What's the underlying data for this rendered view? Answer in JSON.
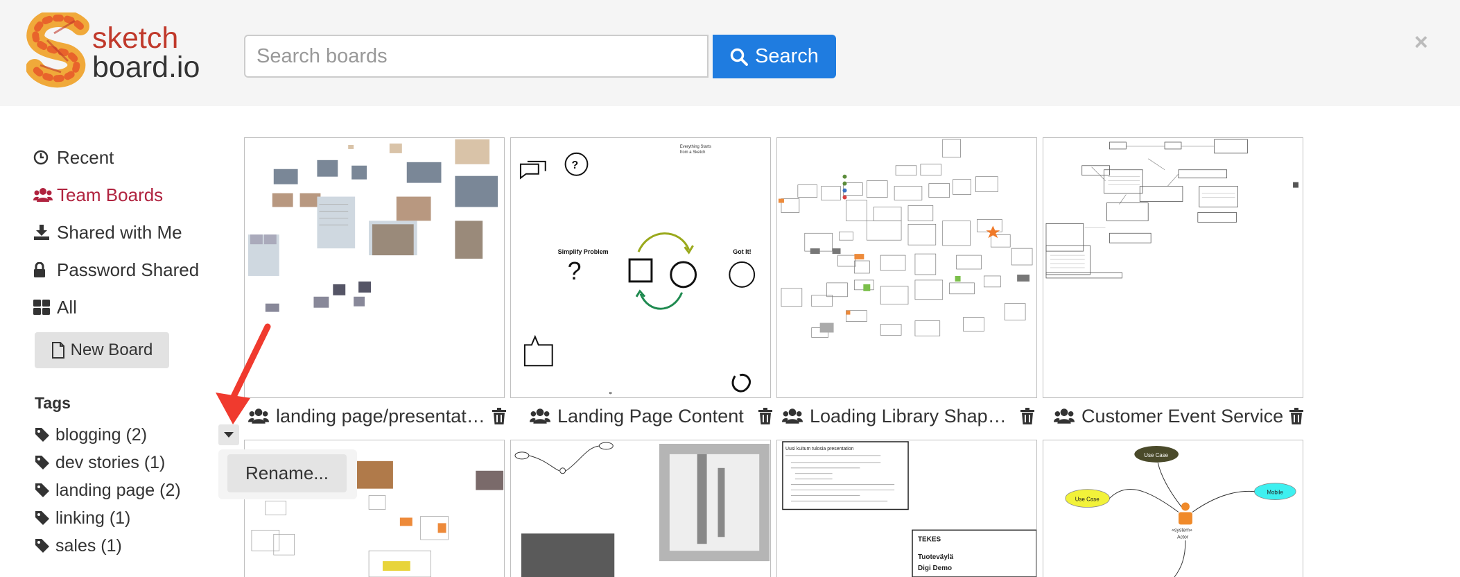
{
  "logo": {
    "line1": "sketch",
    "line2": "board.io"
  },
  "search": {
    "placeholder": "Search boards",
    "value": "",
    "button_label": "Search"
  },
  "close_label": "×",
  "sidebar": {
    "items": [
      {
        "label": "Recent",
        "icon": "clock-icon",
        "active": false
      },
      {
        "label": "Team Boards",
        "icon": "users-icon",
        "active": true
      },
      {
        "label": "Shared with Me",
        "icon": "download-icon",
        "active": false
      },
      {
        "label": "Password Shared",
        "icon": "lock-icon",
        "active": false
      },
      {
        "label": "All",
        "icon": "grid-icon",
        "active": false
      }
    ],
    "new_board_label": "New Board",
    "tags_title": "Tags",
    "tags": [
      {
        "label": "blogging (2)"
      },
      {
        "label": "dev stories (1)"
      },
      {
        "label": "landing page (2)"
      },
      {
        "label": "linking (1)"
      },
      {
        "label": "sales (1)"
      }
    ]
  },
  "boards_row1": [
    {
      "title": "landing page/presentati…"
    },
    {
      "title": "Landing Page Content"
    },
    {
      "title": "Loading Library Shape…"
    },
    {
      "title": "Customer Event Service"
    }
  ],
  "thumb_text": {
    "b2_top": [
      "Everything Starts",
      "from a Sketch"
    ],
    "b2_simplify": "Simplify Problem",
    "b2_gotit": "Got It!",
    "b7_texts": [
      "Uusi kuitum tulosia presentation",
      "TEKES",
      "Tuoteväylä",
      "Digi Demo"
    ],
    "b8_usecase1": "Use Case",
    "b8_usecase2": "Use Case",
    "b8_mobile": "Mobile",
    "b8_actor": "Actor",
    "b8_system": "«system»"
  },
  "context_menu": {
    "rename_label": "Rename..."
  },
  "colors": {
    "accent": "#1f7ce0",
    "active_nav": "#b0233f",
    "arrow": "#f03a2e"
  }
}
